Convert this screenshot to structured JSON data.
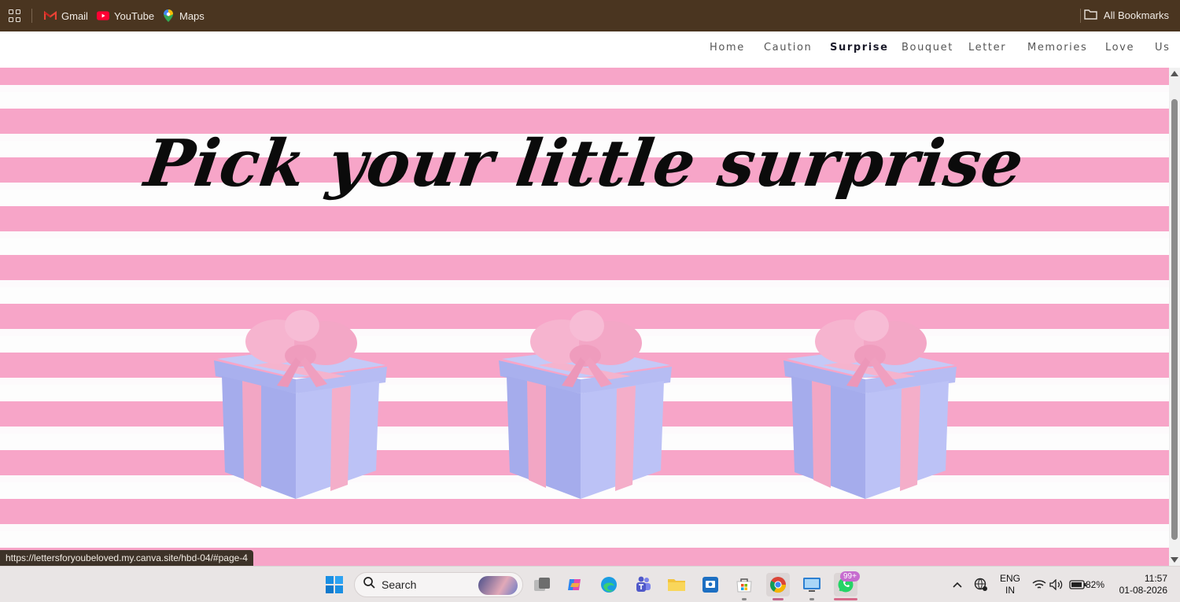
{
  "bookmarks_bar": {
    "items": [
      {
        "label": "Gmail",
        "icon": "gmail-icon"
      },
      {
        "label": "YouTube",
        "icon": "youtube-icon"
      },
      {
        "label": "Maps",
        "icon": "maps-icon"
      }
    ],
    "all_bookmarks_label": "All Bookmarks"
  },
  "nav": {
    "items": [
      "Home",
      "Caution",
      "Surprise",
      "Bouquet",
      "Letter",
      "Memories",
      "Love",
      "Us"
    ],
    "active": "Surprise"
  },
  "page": {
    "headline": "Pick your little surprise",
    "gifts": [
      "gift-box-1",
      "gift-box-2",
      "gift-box-3"
    ],
    "colors": {
      "stripe_pink": "#f7a5c8",
      "box_lavender": "#b6bdf2",
      "ribbon_pink": "#f4a9c6"
    }
  },
  "status_bar": {
    "url": "https://lettersforyoubeloved.my.canva.site/hbd-04/#page-4"
  },
  "taskbar": {
    "search_placeholder": "Search",
    "whatsapp_badge": "99+",
    "language_top": "ENG",
    "language_bottom": "IN",
    "battery": "82%",
    "time": "11:57",
    "date": "01-08-2026"
  }
}
